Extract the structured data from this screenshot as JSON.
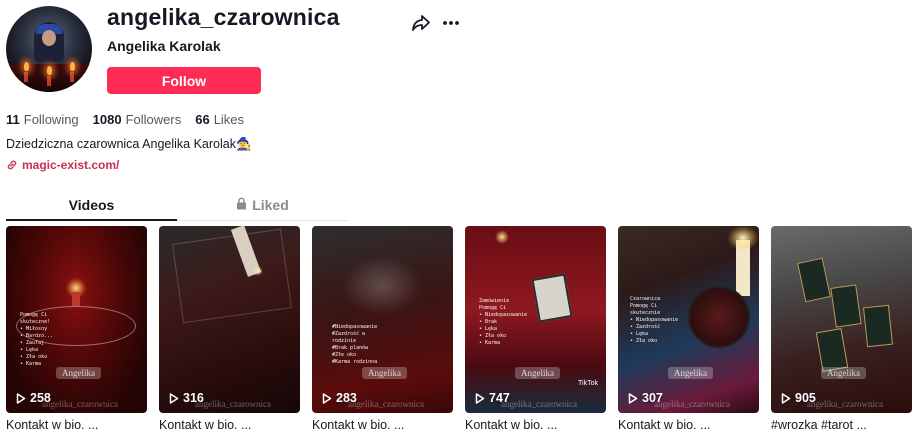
{
  "profile": {
    "username": "angelika_czarownica",
    "full_name": "Angelika Karolak",
    "follow_label": "Follow",
    "bio": "Dziedziczna czarownica Angelika Karolak🧙‍♀️",
    "link": "magic-exist.com/",
    "stats": [
      {
        "value": "11",
        "label": "Following"
      },
      {
        "value": "1080",
        "label": "Followers"
      },
      {
        "value": "66",
        "label": "Likes"
      }
    ]
  },
  "icons": {
    "share": "share-icon",
    "more": "more-icon",
    "link": "link-icon",
    "lock": "lock-icon",
    "play": "play-icon"
  },
  "colors": {
    "accent": "#fe2c55",
    "link": "#c9304e"
  },
  "tabs": [
    {
      "label": "Videos",
      "active": true
    },
    {
      "label": "Liked",
      "active": false
    }
  ],
  "videos": [
    {
      "plays": "258",
      "caption": "Kontakt w bio. ...",
      "watermark": "angelika_czarownica",
      "chip": "Angelika"
    },
    {
      "plays": "316",
      "caption": "Kontakt w bio. ...",
      "watermark": "angelika_czarownica",
      "chip": ""
    },
    {
      "plays": "283",
      "caption": "Kontakt w bio. ...",
      "watermark": "angelika_czarownica",
      "chip": "Angelika"
    },
    {
      "plays": "747",
      "caption": "Kontakt w bio. ...",
      "watermark": "angelika_czarownica",
      "chip": "Angelika",
      "badge": "TikTok"
    },
    {
      "plays": "307",
      "caption": "Kontakt w bio. ...",
      "watermark": "angelika_czarownica",
      "chip": "Angelika"
    },
    {
      "plays": "905",
      "caption": "#wrozka #tarot ...",
      "watermark": "angelika_czarownica",
      "chip": "Angelika"
    }
  ]
}
